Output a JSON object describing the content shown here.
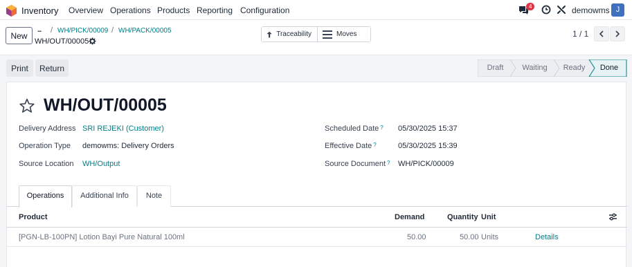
{
  "navbar": {
    "app_name": "Inventory",
    "menus": [
      "Overview",
      "Operations",
      "Products",
      "Reporting",
      "Configuration"
    ],
    "messages_badge": "4",
    "user_name": "demowms",
    "avatar_letter": "J"
  },
  "control": {
    "new_label": "New",
    "breadcrumb_dots": "...",
    "breadcrumbs": [
      "WH/PICK/00009",
      "WH/PACK/00005"
    ],
    "separator": "/",
    "current": "WH/OUT/00005",
    "smart_buttons": [
      "Traceability",
      "Moves"
    ],
    "pager": "1 / 1"
  },
  "actions": {
    "print_label": "Print",
    "return_label": "Return"
  },
  "statusbar": {
    "stages": [
      "Draft",
      "Waiting",
      "Ready",
      "Done"
    ],
    "active": "Done"
  },
  "form": {
    "title": "WH/OUT/00005",
    "left_fields": [
      {
        "label": "Delivery Address",
        "value": "SRI REJEKI (Customer)"
      },
      {
        "label": "Operation Type",
        "value": "demowms: Delivery Orders"
      },
      {
        "label": "Source Location",
        "value": "WH/Output"
      }
    ],
    "right_fields": [
      {
        "label": "Scheduled Date",
        "help": "?",
        "value": "05/30/2025 15:37"
      },
      {
        "label": "Effective Date",
        "help": "?",
        "value": "05/30/2025 15:39"
      },
      {
        "label": "Source Document",
        "help": "?",
        "value": "WH/PICK/00009"
      }
    ]
  },
  "tabs": [
    "Operations",
    "Additional Info",
    "Note"
  ],
  "table": {
    "headers": {
      "product": "Product",
      "demand": "Demand",
      "quantity": "Quantity",
      "unit": "Unit"
    },
    "rows": [
      {
        "product": "[PGN-LB-100PN] Lotion Bayi Pure Natural 100ml",
        "demand": "50.00",
        "quantity": "50.00",
        "unit": "Units",
        "action": "Details"
      }
    ]
  },
  "colors": {
    "accent": "#017e84",
    "brand": "#714b67",
    "badge": "#dc3545",
    "avatar": "#3f6fbf"
  }
}
